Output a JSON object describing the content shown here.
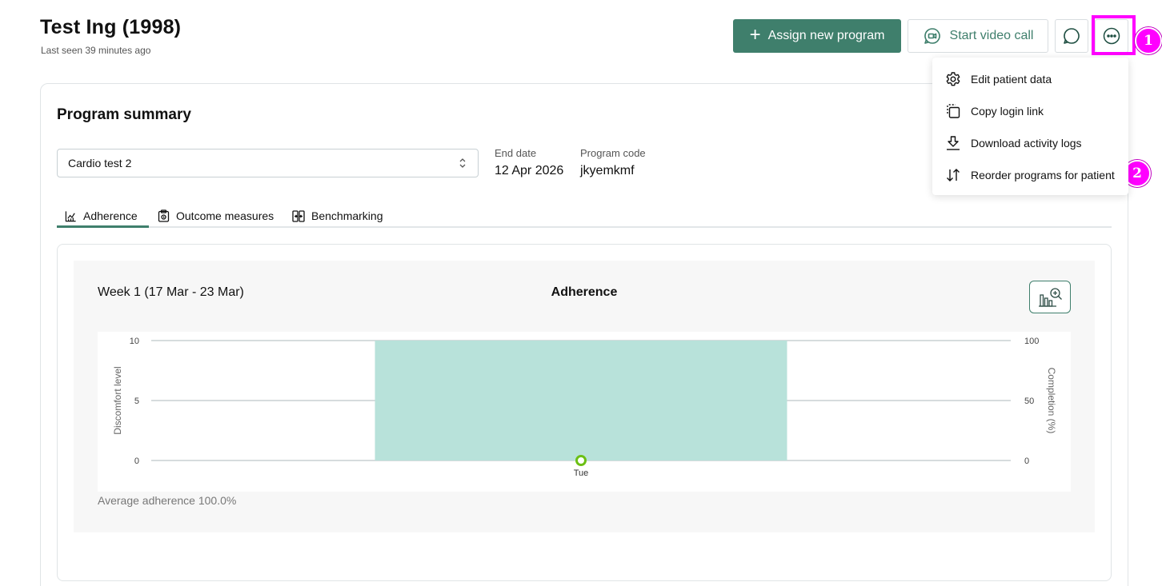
{
  "header": {
    "patient_name": "Test Ing (1998)",
    "last_seen": "Last seen 39 minutes ago",
    "assign_label": "Assign new program",
    "video_label": "Start video call"
  },
  "menu": {
    "items": [
      {
        "label": "Edit patient data",
        "icon": "gear-icon"
      },
      {
        "label": "Copy login link",
        "icon": "copy-icon"
      },
      {
        "label": "Download activity logs",
        "icon": "download-icon"
      },
      {
        "label": "Reorder programs for patient",
        "icon": "reorder-icon"
      }
    ]
  },
  "annotations": {
    "badge1": "1",
    "badge2": "2",
    "highlight_color": "#ff00ff"
  },
  "summary": {
    "title": "Program summary",
    "selected_program": "Cardio test 2",
    "end_date_label": "End date",
    "end_date_value": "12 Apr 2026",
    "program_code_label": "Program code",
    "program_code_value": "jkyemkmf"
  },
  "tabs": [
    {
      "label": "Adherence",
      "active": true
    },
    {
      "label": "Outcome measures",
      "active": false
    },
    {
      "label": "Benchmarking",
      "active": false
    }
  ],
  "chart": {
    "week_label": "Week 1 (17 Mar - 23 Mar)",
    "title": "Adherence",
    "avg_adherence": "Average adherence 100.0%"
  },
  "colors": {
    "accent": "#3f7f6c",
    "bar": "#b8e2da",
    "point": "#6cc015"
  },
  "chart_data": {
    "type": "bar",
    "categories": [
      "Tue"
    ],
    "series": [
      {
        "name": "Completion (%)",
        "type": "bar",
        "axis": "right",
        "values": [
          100
        ]
      },
      {
        "name": "Discomfort level",
        "type": "point",
        "axis": "left",
        "values": [
          0
        ]
      }
    ],
    "ylabel_left": "Discomfort level",
    "ylabel_right": "Completion (%)",
    "ylim_left": [
      0,
      10
    ],
    "ylim_right": [
      0,
      100
    ],
    "yticks_left": [
      0,
      5,
      10
    ],
    "yticks_right": [
      0,
      50,
      100
    ],
    "grid": true
  }
}
